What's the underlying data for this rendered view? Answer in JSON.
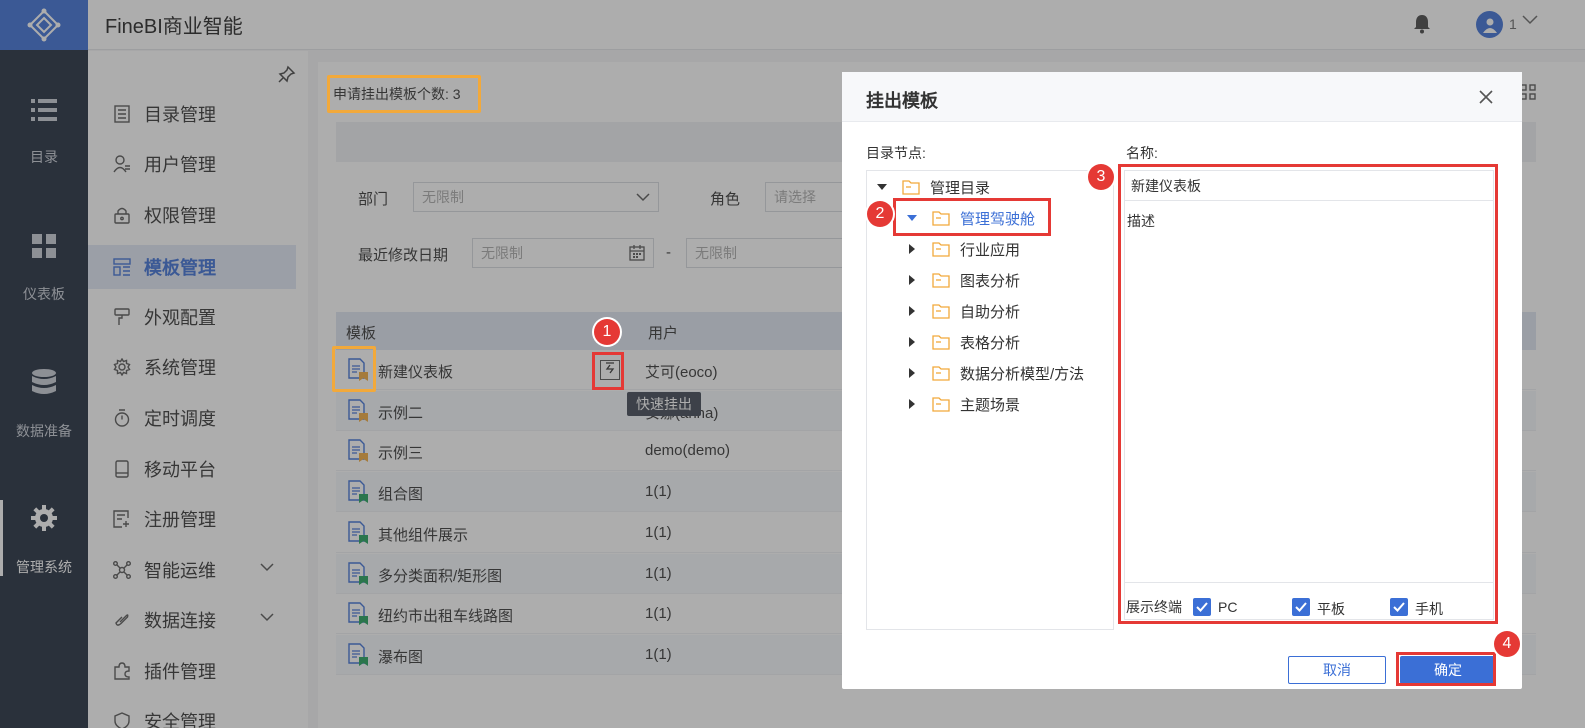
{
  "app": {
    "title": "FineBI商业智能",
    "user_name": "1"
  },
  "rail": [
    {
      "label": "目录",
      "icon": "list-icon"
    },
    {
      "label": "仪表板",
      "icon": "dashboard-icon"
    },
    {
      "label": "数据准备",
      "icon": "database-icon"
    },
    {
      "label": "管理系统",
      "icon": "gear-icon",
      "active": true
    }
  ],
  "sidebar": {
    "items": [
      {
        "label": "目录管理"
      },
      {
        "label": "用户管理"
      },
      {
        "label": "权限管理"
      },
      {
        "label": "模板管理",
        "active": true
      },
      {
        "label": "外观配置"
      },
      {
        "label": "系统管理"
      },
      {
        "label": "定时调度"
      },
      {
        "label": "移动平台"
      },
      {
        "label": "注册管理"
      },
      {
        "label": "智能运维",
        "expandable": true
      },
      {
        "label": "数据连接",
        "expandable": true
      },
      {
        "label": "插件管理"
      },
      {
        "label": "安全管理"
      }
    ]
  },
  "main": {
    "apply_count": "申请挂出模板个数: 3",
    "filters": {
      "dept_label": "部门",
      "dept_value": "无限制",
      "role_label": "角色",
      "role_placeholder": "请选择",
      "date_label": "最近修改日期",
      "date_from": "无限制",
      "date_sep": "-",
      "date_to": "无限制"
    },
    "table": {
      "columns": [
        "模板",
        "用户"
      ],
      "rows": [
        {
          "name": "新建仪表板",
          "user": "艾可(eoco)",
          "flag": "orange"
        },
        {
          "name": "示例二",
          "user": "安娜(anna)",
          "flag": "orange"
        },
        {
          "name": "示例三",
          "user": "demo(demo)",
          "flag": "orange"
        },
        {
          "name": "组合图",
          "user": "1(1)",
          "flag": "green"
        },
        {
          "name": "其他组件展示",
          "user": "1(1)",
          "flag": "green"
        },
        {
          "name": "多分类面积/矩形图",
          "user": "1(1)",
          "flag": "green"
        },
        {
          "name": "纽约市出租车线路图",
          "user": "1(1)",
          "flag": "green"
        },
        {
          "name": "瀑布图",
          "user": "1(1)",
          "flag": "green"
        }
      ]
    },
    "quick_publish_tooltip": "快速挂出"
  },
  "dialog": {
    "title": "挂出模板",
    "tree_label": "目录节点:",
    "name_label": "名称:",
    "tree": [
      {
        "label": "管理目录",
        "level": 0,
        "expanded": true
      },
      {
        "label": "管理驾驶舱",
        "level": 1,
        "expanded": true,
        "selected": true
      },
      {
        "label": "行业应用",
        "level": 2
      },
      {
        "label": "图表分析",
        "level": 2
      },
      {
        "label": "自助分析",
        "level": 2
      },
      {
        "label": "表格分析",
        "level": 2
      },
      {
        "label": "数据分析模型/方法",
        "level": 2
      },
      {
        "label": "主题场景",
        "level": 2
      }
    ],
    "name_value": "新建仪表板",
    "desc_placeholder": "描述",
    "terminals_label": "展示终端",
    "terminals": [
      {
        "label": "PC",
        "checked": true
      },
      {
        "label": "平板",
        "checked": true
      },
      {
        "label": "手机",
        "checked": true
      }
    ],
    "cancel_label": "取消",
    "ok_label": "确定"
  },
  "annotations": {
    "step1": "1",
    "step2": "2",
    "step3": "3",
    "step4": "4"
  },
  "colors": {
    "accent": "#3b6fd6",
    "rail": "#1e2a3c",
    "highlight_orange": "#f2a93b",
    "highlight_red": "#e53935"
  }
}
